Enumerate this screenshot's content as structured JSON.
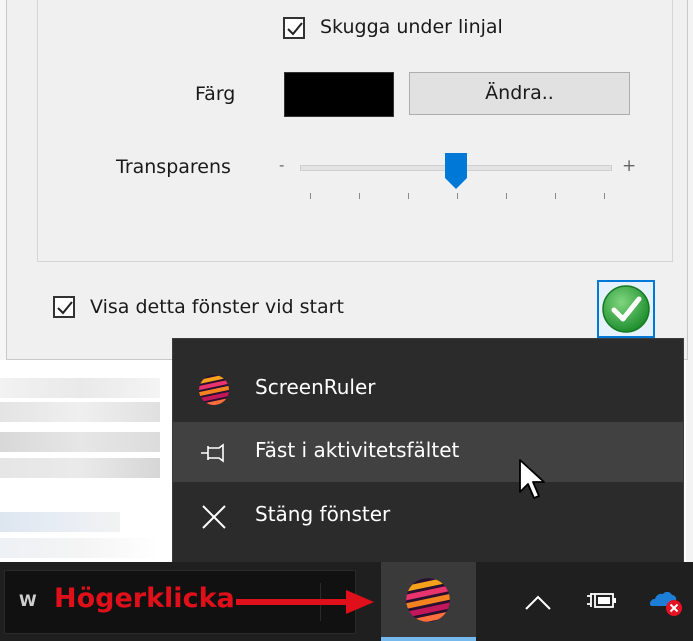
{
  "dialog": {
    "shadow_checkbox_label": "Skugga under linjal",
    "shadow_checked": true,
    "color_label": "Färg",
    "color_value": "#000000",
    "change_button_label": "Ändra..",
    "transparency_label": "Transparens",
    "slider_min_label": "-",
    "slider_max_label": "+",
    "transparency_level": 0.5,
    "startup_checkbox_label": "Visa detta fönster vid start",
    "startup_checked": true,
    "ok_icon": "checkmark-circle-icon"
  },
  "context_menu": {
    "items": [
      {
        "label": "ScreenRuler",
        "icon": "screenruler-app-icon"
      },
      {
        "label": "Fäst i aktivitetsfältet",
        "icon": "pin-icon"
      },
      {
        "label": "Stäng fönster",
        "icon": "close-icon"
      }
    ],
    "hovered_index": 1
  },
  "annotation": {
    "text": "Högerklicka",
    "color": "#e0101a"
  },
  "taskbar": {
    "left_glyph": "W",
    "app_icon": "screenruler-app-icon",
    "tray_icons": [
      "chevron-up-icon",
      "battery-charging-icon",
      "onedrive-error-icon"
    ]
  },
  "colors": {
    "menu_bg": "#2b2b2b",
    "menu_hover": "#414141",
    "taskbar_bg": "#1f1f1f",
    "accent": "#0078d7",
    "slider_thumb": "#0078d7"
  }
}
